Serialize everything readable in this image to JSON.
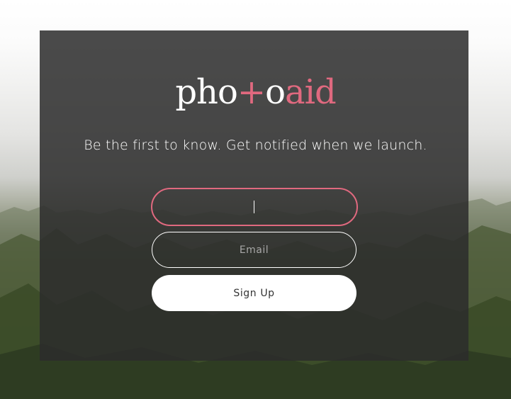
{
  "brand": {
    "logo_part1": "pho",
    "logo_plus": "+",
    "logo_part2": "o",
    "logo_part3": "aid",
    "accent_color": "#e0697f",
    "text_color": "#ffffff"
  },
  "hero": {
    "tagline": "Be the first to know. Get notified when we launch."
  },
  "form": {
    "name_field": {
      "value": "",
      "placeholder": ""
    },
    "email_field": {
      "value": "",
      "placeholder": "Email"
    },
    "signup_label": "Sign Up"
  },
  "background": {
    "description_icon": "mountain-landscape-image"
  }
}
